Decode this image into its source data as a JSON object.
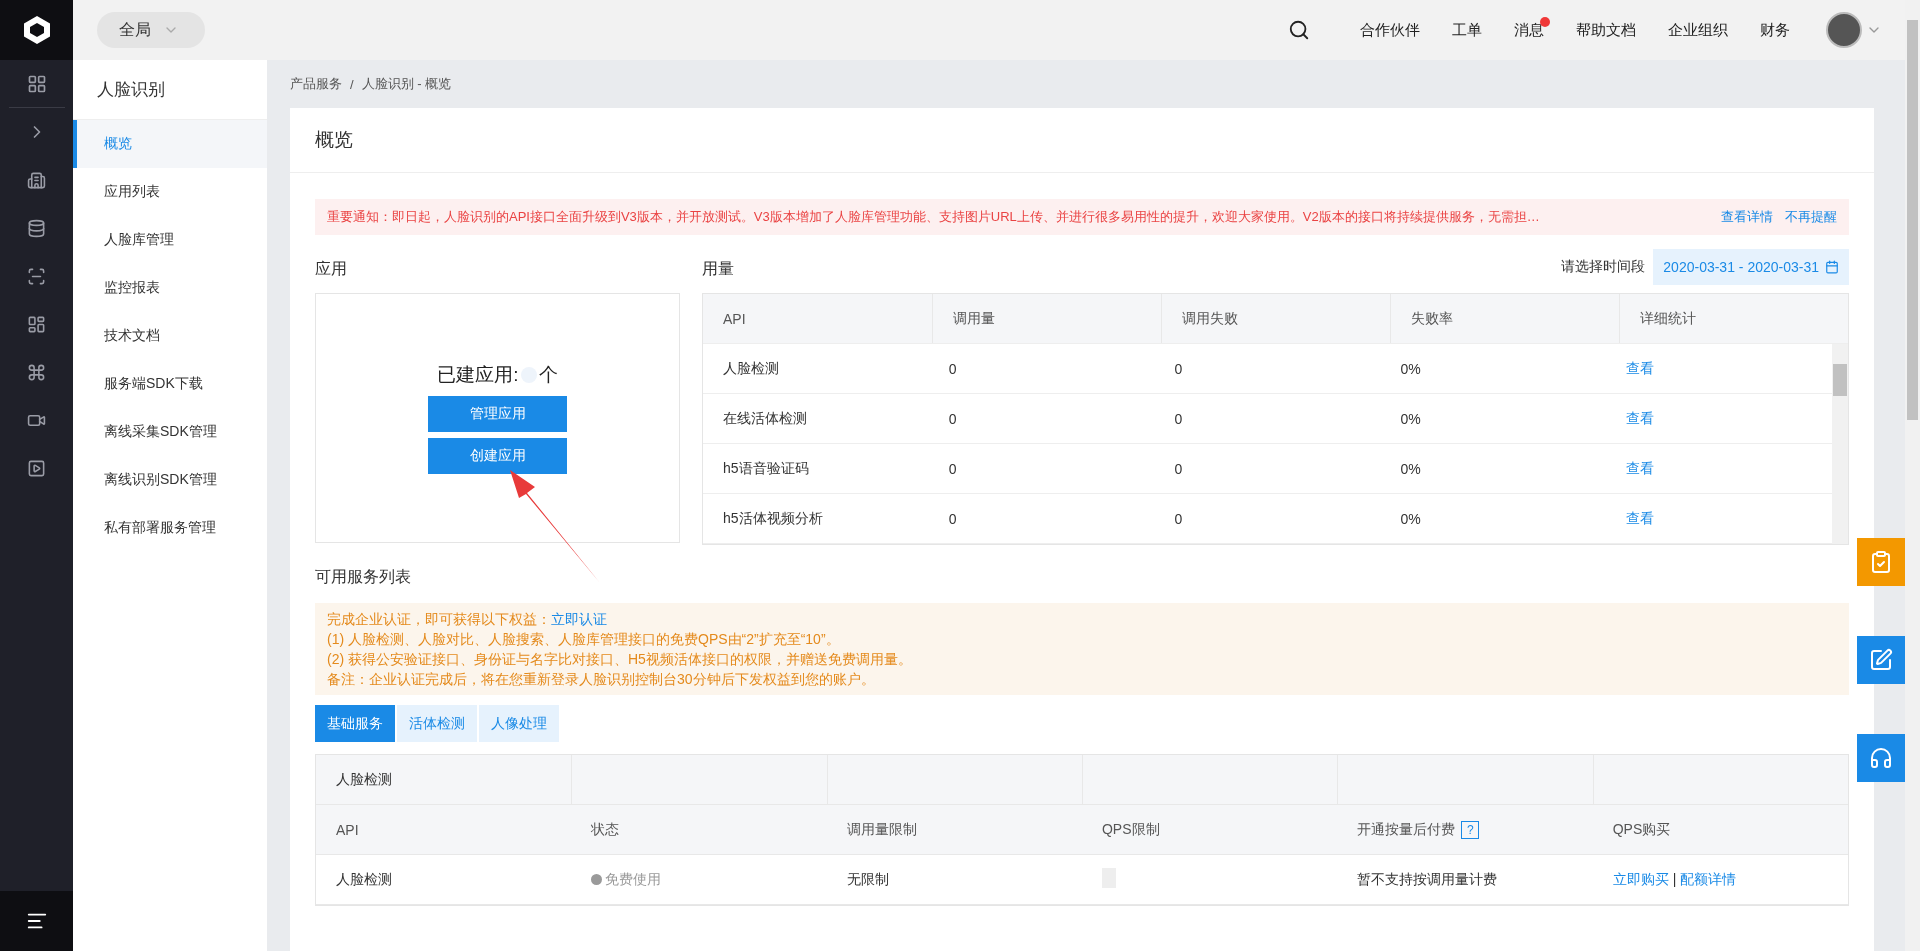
{
  "top_bar": {
    "scope": "全局",
    "nav": [
      {
        "label": "合作伙伴",
        "badge": false
      },
      {
        "label": "工单",
        "badge": false
      },
      {
        "label": "消息",
        "badge": true
      },
      {
        "label": "帮助文档",
        "badge": false
      },
      {
        "label": "企业组织",
        "badge": false
      },
      {
        "label": "财务",
        "badge": false
      }
    ]
  },
  "sidebar": {
    "title": "人脸识别",
    "items": [
      {
        "label": "概览",
        "selected": true
      },
      {
        "label": "应用列表",
        "selected": false
      },
      {
        "label": "人脸库管理",
        "selected": false
      },
      {
        "label": "监控报表",
        "selected": false
      },
      {
        "label": "技术文档",
        "selected": false
      },
      {
        "label": "服务端SDK下载",
        "selected": false
      },
      {
        "label": "离线采集SDK管理",
        "selected": false
      },
      {
        "label": "离线识别SDK管理",
        "selected": false
      },
      {
        "label": "私有部署服务管理",
        "selected": false
      }
    ]
  },
  "breadcrumb": {
    "items": [
      "产品服务",
      "人脸识别 - 概览"
    ],
    "separator": "/"
  },
  "page_title": "概览",
  "notice": {
    "text": "重要通知：即日起，人脸识别的API接口全面升级到V3版本，并开放测试。V3版本增加了人脸库管理功能、支持图片URL上传、并进行很多易用性的提升，欢迎大家使用。V2版本的接口将持续提供服务，无需担…",
    "links": [
      "查看详情",
      "不再提醒"
    ]
  },
  "apps": {
    "title": "应用",
    "count_label": "已建应用:",
    "count_unit": "个",
    "buttons": [
      "管理应用",
      "创建应用"
    ]
  },
  "usage": {
    "title": "用量",
    "date_label": "请选择时间段",
    "date_range": "2020-03-31 - 2020-03-31",
    "columns": [
      "API",
      "调用量",
      "调用失败",
      "失败率",
      "详细统计"
    ],
    "rows": [
      [
        "人脸检测",
        "0",
        "0",
        "0%",
        "查看"
      ],
      [
        "在线活体检测",
        "0",
        "0",
        "0%",
        "查看"
      ],
      [
        "h5语音验证码",
        "0",
        "0",
        "0%",
        "查看"
      ],
      [
        "h5活体视频分析",
        "0",
        "0",
        "0%",
        "查看"
      ]
    ]
  },
  "services": {
    "title": "可用服务列表",
    "benefits": {
      "lead": "完成企业认证，即可获得以下权益：",
      "link": "立即认证",
      "lines": [
        "(1) 人脸检测、人脸对比、人脸搜索、人脸库管理接口的免费QPS由“2”扩充至“10”。",
        "(2) 获得公安验证接口、身份证与名字比对接口、H5视频活体接口的权限，并赠送免费调用量。",
        "备注：企业认证完成后，将在您重新登录人脸识别控制台30分钟后下发权益到您的账户。"
      ]
    },
    "tabs": [
      {
        "label": "基础服务",
        "selected": true
      },
      {
        "label": "活体检测",
        "selected": false
      },
      {
        "label": "人像处理",
        "selected": false
      }
    ],
    "group": "人脸检测",
    "columns": [
      "API",
      "状态",
      "调用量限制",
      "QPS限制",
      "开通按量后付费",
      "QPS购买"
    ],
    "help": "?",
    "rows": [
      {
        "api": "人脸检测",
        "status": "免费使用",
        "limit": "无限制",
        "fee": "暂不支持按调用量计费",
        "actions": [
          "立即购买",
          "配额详情"
        ],
        "separator": "|"
      }
    ]
  }
}
